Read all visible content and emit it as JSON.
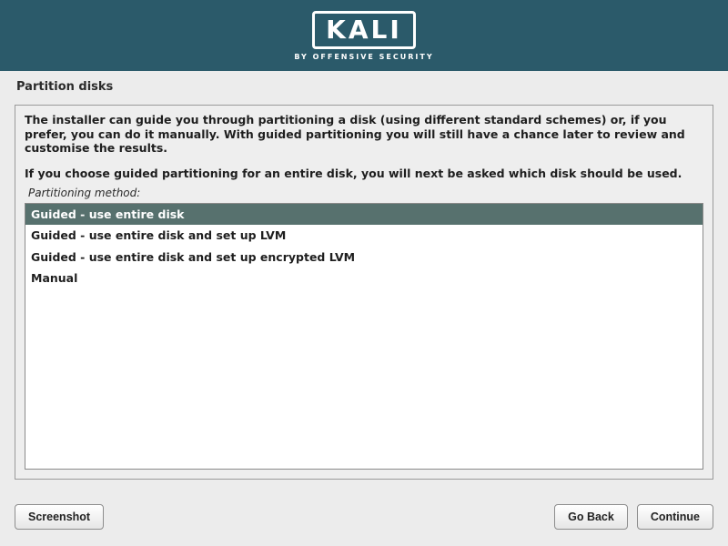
{
  "banner": {
    "logo_text": "KALI",
    "logo_sub": "BY OFFENSIVE SECURITY"
  },
  "page": {
    "title": "Partition disks"
  },
  "content": {
    "desc1": "The installer can guide you through partitioning a disk (using different standard schemes) or, if you prefer, you can do it manually. With guided partitioning you will still have a chance later to review and customise the results.",
    "desc2": "If you choose guided partitioning for an entire disk, you will next be asked which disk should be used.",
    "method_label": "Partitioning method:",
    "options": [
      "Guided - use entire disk",
      "Guided - use entire disk and set up LVM",
      "Guided - use entire disk and set up encrypted LVM",
      "Manual"
    ],
    "selected_index": 0
  },
  "buttons": {
    "screenshot": "Screenshot",
    "go_back": "Go Back",
    "continue": "Continue"
  }
}
